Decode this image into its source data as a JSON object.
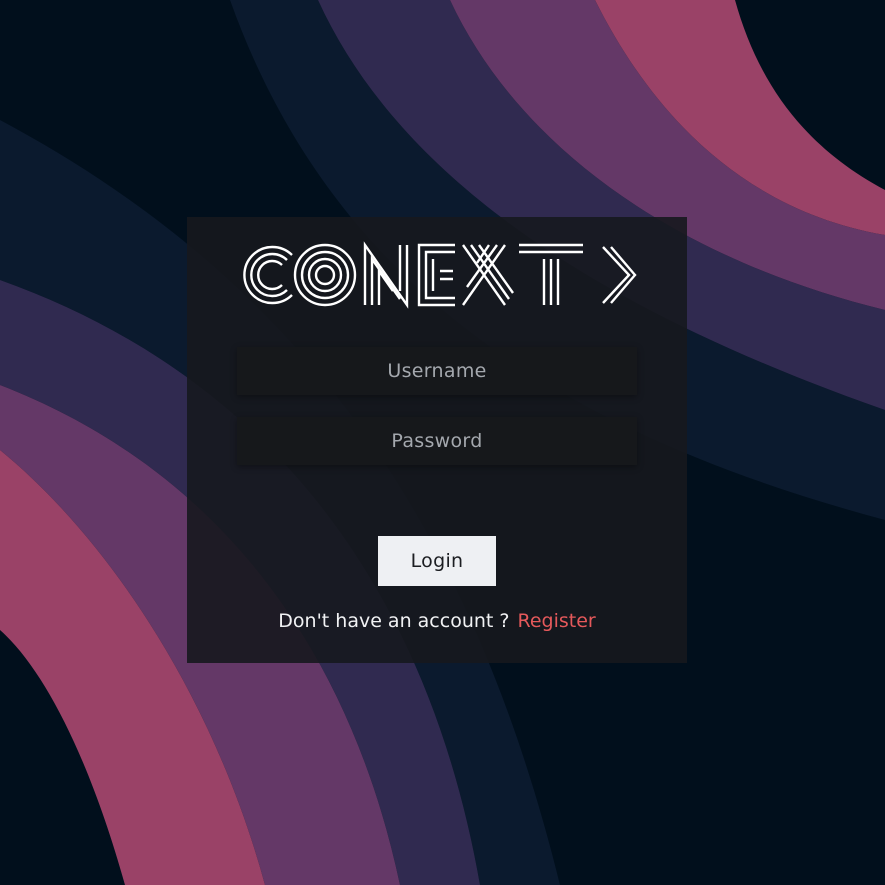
{
  "brand": {
    "logo_text": "CONEXT",
    "logo_glyph": "chevron-right-icon"
  },
  "form": {
    "username_placeholder": "Username",
    "password_placeholder": "Password",
    "login_label": "Login"
  },
  "footer": {
    "prompt": "Don't have an account ?",
    "register_label": "Register"
  },
  "colors": {
    "background_base": "#010f1c",
    "band_navy": "#0b1a2e",
    "band_indigo": "#302a50",
    "band_plum": "#643867",
    "band_rose": "#9a4267",
    "card": "#16181e",
    "input_bg": "#16181b",
    "button_bg": "#eef0f3",
    "link": "#e5595b"
  }
}
